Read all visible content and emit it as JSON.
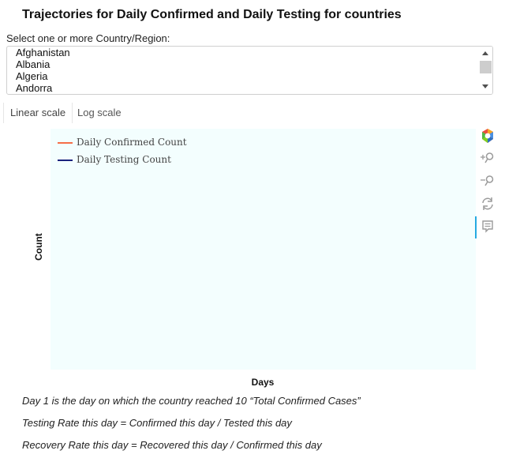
{
  "title": "Trajectories for Daily Confirmed and Daily Testing for countries",
  "country_select": {
    "label": "Select one or more Country/Region:",
    "visible_options": [
      "Afghanistan",
      "Albania",
      "Algeria",
      "Andorra"
    ]
  },
  "tabs": [
    {
      "label": "Linear scale",
      "active": true
    },
    {
      "label": "Log scale",
      "active": false
    }
  ],
  "chart_data": {
    "type": "line",
    "xlabel": "Days",
    "ylabel": "Count",
    "series": [
      {
        "name": "Daily Confirmed Count",
        "color": "#f56e48",
        "values": []
      },
      {
        "name": "Daily Testing Count",
        "color": "#1a237e",
        "values": []
      }
    ],
    "plot_background": "#f3fefe",
    "legend_position": "top-left",
    "grid": false
  },
  "toolbar": {
    "tools": [
      "bokeh-logo-icon",
      "zoom-in-icon",
      "zoom-out-icon",
      "reset-icon",
      "hover-tooltip-icon"
    ]
  },
  "notes": [
    "Day 1 is the day on which the country reached 10 “Total Confirmed Cases”",
    "Testing Rate this day = Confirmed this day / Tested this day",
    "Recovery Rate this day = Recovered this day / Confirmed this day"
  ],
  "colors": {
    "accent": "#26aae1",
    "confirmed": "#f56e48",
    "testing": "#1a237e"
  }
}
